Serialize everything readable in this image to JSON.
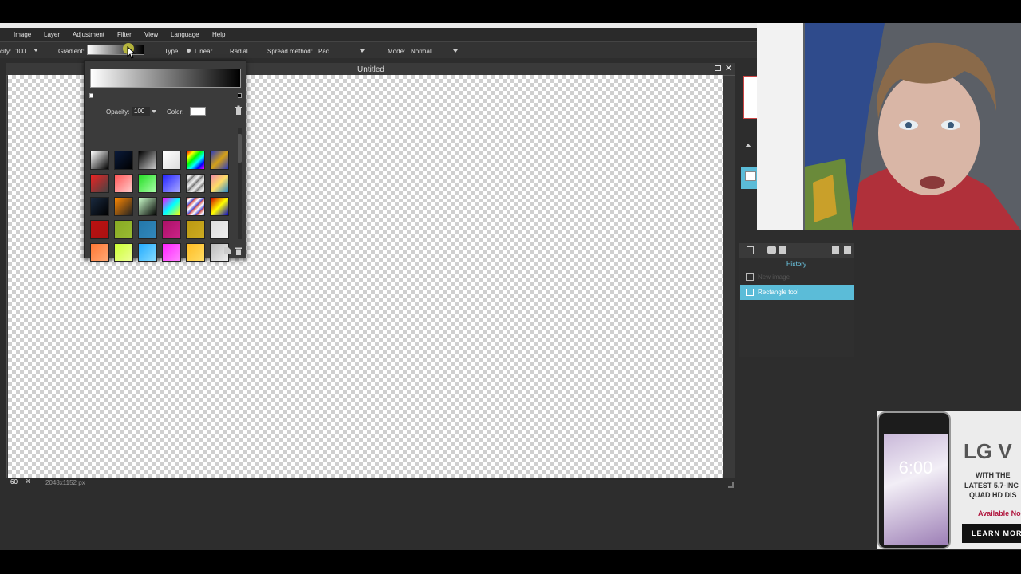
{
  "menu": [
    "Image",
    "Layer",
    "Adjustment",
    "Filter",
    "View",
    "Language",
    "Help"
  ],
  "options": {
    "opacity_label": "city:",
    "opacity_value": "100",
    "gradient_label": "Gradient:",
    "type_label": "Type:",
    "type_linear": "Linear",
    "type_radial": "Radial",
    "spread_label": "Spread method:",
    "spread_value": "Pad",
    "mode_label": "Mode:",
    "mode_value": "Normal"
  },
  "canvas": {
    "title": "Untitled",
    "zoom_value": "60",
    "zoom_unit": "%",
    "dimensions": "2048x1152 px"
  },
  "gradient_popup": {
    "opacity_label": "Opacity:",
    "opacity_value": "100",
    "color_label": "Color:",
    "color_value": "#ffffff",
    "presets": [
      "linear-gradient(135deg,#fff,#000)",
      "linear-gradient(135deg,#0a1a3a,#000)",
      "linear-gradient(135deg,#000,#ccc)",
      "linear-gradient(135deg,#fff,#ddd)",
      "linear-gradient(135deg,#f00,#ff0,#0f0,#0ff,#00f,#f0f)",
      "linear-gradient(135deg,#2b3cbf,#d4a017,#2b3cbf)",
      "linear-gradient(135deg,#e22,#444)",
      "linear-gradient(135deg,#f55,#fcc)",
      "linear-gradient(135deg,#2d2,#afa)",
      "linear-gradient(135deg,#22f,#aaf)",
      "repeating-linear-gradient(135deg,#aaa 0,#eee 4px,#666 8px)",
      "linear-gradient(135deg,#e8a,#fd6,#28c)",
      "linear-gradient(135deg,#1a2a40,#000)",
      "linear-gradient(135deg,#f80,#222)",
      "linear-gradient(135deg,#cfc,#000)",
      "linear-gradient(135deg,#f0f,#0ff,#ff0)",
      "repeating-linear-gradient(135deg,#c44 0,#fff 4px,#44c 8px)",
      "linear-gradient(135deg,#c00,#ff0,#00c)",
      "linear-gradient(135deg,#b11,#a11)",
      "linear-gradient(135deg,#8a2,#9b3)",
      "linear-gradient(135deg,#27a,#38b)",
      "linear-gradient(135deg,#a16,#c28)",
      "linear-gradient(135deg,#b91,#ca2)",
      "linear-gradient(135deg,#ddd,#eee)",
      "linear-gradient(135deg,#f73,#fa7)",
      "linear-gradient(135deg,#cf3,#ef9)",
      "linear-gradient(135deg,#2af,#8df)",
      "linear-gradient(135deg,#f2f,#f8f)",
      "linear-gradient(135deg,#fb2,#fd6)",
      "linear-gradient(135deg,#bbb,#eee)"
    ]
  },
  "history": {
    "title": "History",
    "items": [
      "New image",
      "Rectangle tool"
    ],
    "selected_index": 1
  },
  "ad": {
    "brand": "LG V",
    "time": "6:00",
    "line1": "WITH THE",
    "line2": "LATEST 5.7-INC",
    "line3": "QUAD HD DIS",
    "line4": "Available No",
    "cta": "LEARN MOR"
  },
  "colors": {
    "accent": "#5bbcd8",
    "panel": "#2d2d2d",
    "toolbar": "#333333"
  }
}
